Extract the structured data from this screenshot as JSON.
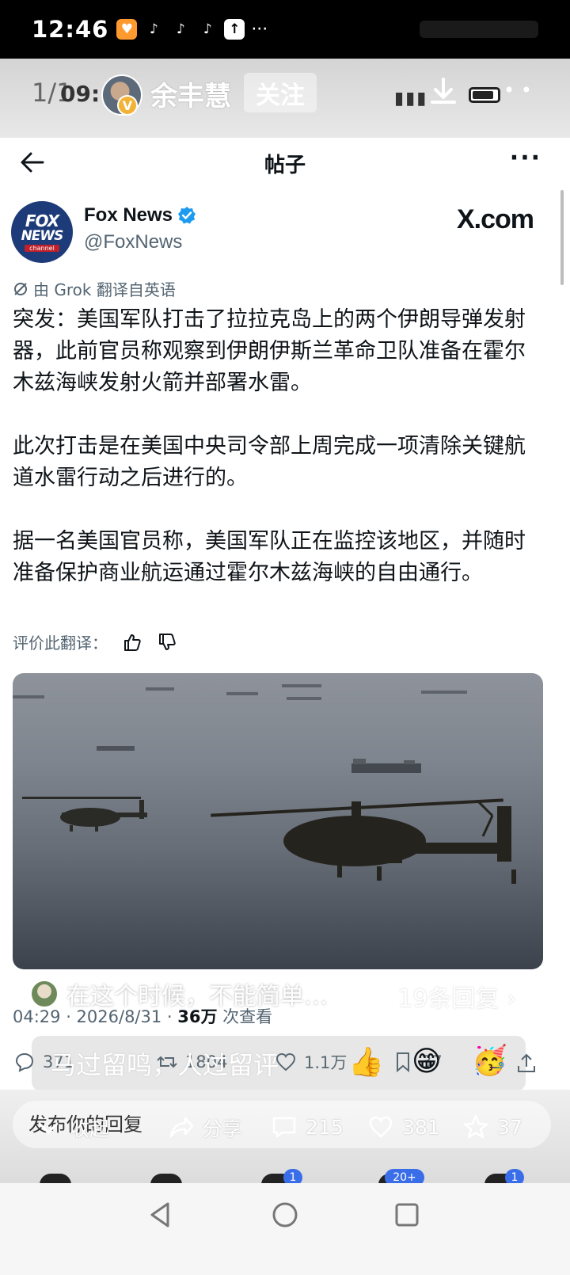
{
  "status_bar": {
    "time": "12:46",
    "app_icons": [
      "heart-app-icon",
      "tiktok-icon",
      "tiktok-icon",
      "tiktok-icon",
      "upload-icon"
    ],
    "overflow": "···"
  },
  "viewer": {
    "counter": "1/1",
    "ghost_time": "09:",
    "user_name": "余丰慧",
    "verified_badge": "V",
    "follow_label": "关注"
  },
  "post_nav": {
    "title": "帖子",
    "more": "···"
  },
  "author": {
    "logo_line1": "FOX",
    "logo_line2": "NEWS",
    "logo_line3": "channel",
    "name": "Fox News",
    "handle": "@FoxNews",
    "source": "X.com"
  },
  "translation_note": "由 Grok 翻译自英语",
  "body_paragraphs": [
    "突发：美国军队打击了拉拉克岛上的两个伊朗导弹发射器，此前官员称观察到伊朗伊斯兰革命卫队准备在霍尔木兹海峡发射火箭并部署水雷。",
    "此次打击是在美国中央司令部上周完成一项清除关键航道水雷行动之后进行的。",
    "据一名美国官员称，美国军队正在监控该地区，并随时准备保护商业航运通过霍尔木兹海峡的自由通行。"
  ],
  "rate_translation": "评价此翻译：",
  "comment_overlay": {
    "text": "在这个时候，不能简单…",
    "replies": "19条回复"
  },
  "meta": {
    "time_date": "04:29 · 2026/8/31 · ",
    "views": "36万",
    "views_suffix": " 次查看"
  },
  "stats": {
    "replies": "371",
    "reposts": "1804",
    "likes": "1.1万",
    "bookmarks": "37"
  },
  "danmaku": "马过留鸣，人过留评",
  "bottom": {
    "reply_placeholder": "发布你的回复",
    "collapse": "收起",
    "share": "分享",
    "comments": "215",
    "likes": "381",
    "favorites": "37",
    "tab_badges": [
      "1",
      "20+",
      "1"
    ]
  },
  "colors": {
    "accent_blue": "#1d9bf0",
    "text_primary": "#0f1419",
    "text_secondary": "#536471",
    "fox_blue": "#1d3b78",
    "badge_blue": "#3a6ee8"
  }
}
